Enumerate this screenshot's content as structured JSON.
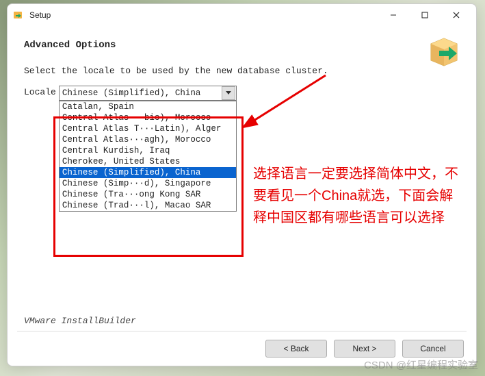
{
  "window": {
    "title": "Setup"
  },
  "page": {
    "heading": "Advanced Options",
    "instruction": "Select the locale to be used by the new database cluster.",
    "locale_label": "Locale",
    "footer_brand": "VMware InstallBuilder"
  },
  "combo": {
    "selected": "Chinese (Simplified), China",
    "options": [
      "Catalan, Spain",
      "Central Atlas···bic), Morocco",
      "Central Atlas T···Latin), Alger",
      "Central Atlas···agh), Morocco",
      "Central Kurdish, Iraq",
      "Cherokee, United States",
      "Chinese (Simplified), China",
      "Chinese (Simp···d), Singapore",
      "Chinese (Tra···ong Kong SAR",
      "Chinese (Trad···l), Macao SAR"
    ],
    "selected_index": 6
  },
  "buttons": {
    "back": "< Back",
    "next": "Next >",
    "cancel": "Cancel"
  },
  "annotation": {
    "text": "选择语言一定要选择简体中文，不要看见一个China就选，下面会解释中国区都有哪些语言可以选择"
  },
  "watermark": "CSDN @红星编程实验室"
}
